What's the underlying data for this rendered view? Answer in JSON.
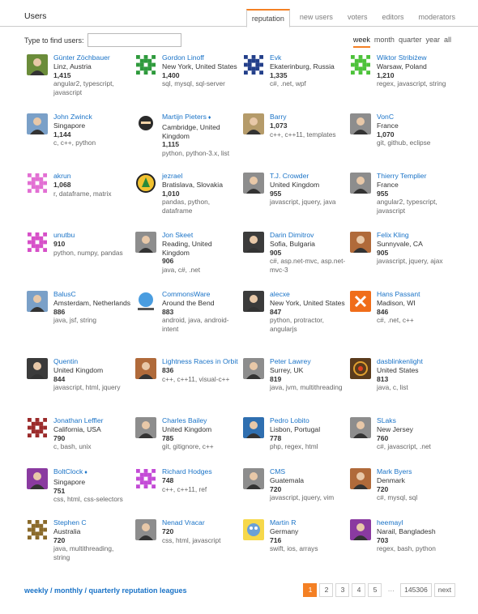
{
  "header": {
    "title": "Users",
    "tabs": [
      "reputation",
      "new users",
      "voters",
      "editors",
      "moderators"
    ]
  },
  "filter": {
    "label": "Type to find users:",
    "value": "",
    "placeholder": ""
  },
  "periods": [
    "week",
    "month",
    "quarter",
    "year",
    "all"
  ],
  "users": [
    {
      "name": "Günter Zöchbauer",
      "mod": false,
      "location": "Linz, Austria",
      "rep": "1,415",
      "tags": "angular2, typescript, javascript",
      "avatar": "photo-cyclist"
    },
    {
      "name": "Gordon Linoff",
      "mod": false,
      "location": "New York, United States",
      "rep": "1,400",
      "tags": "sql, mysql, sql-server",
      "avatar": "identicon-green"
    },
    {
      "name": "Evk",
      "mod": false,
      "location": "Ekaterinburg, Russia",
      "rep": "1,335",
      "tags": "c#, .net, wpf",
      "avatar": "identicon-navy"
    },
    {
      "name": "Wiktor Stribiżew",
      "mod": false,
      "location": "Warsaw, Poland",
      "rep": "1,210",
      "tags": "regex, javascript, string",
      "avatar": "identicon-lime"
    },
    {
      "name": "John Zwinck",
      "mod": false,
      "location": "Singapore",
      "rep": "1,144",
      "tags": "c, c++, python",
      "avatar": "photo-landscape"
    },
    {
      "name": "Martijn Pieters",
      "mod": true,
      "location": "Cambridge, United Kingdom",
      "rep": "1,115",
      "tags": "python, python-3.x, list",
      "avatar": "photo-ninja"
    },
    {
      "name": "Barry",
      "mod": false,
      "location": "",
      "rep": "1,073",
      "tags": "c++, c++11, templates",
      "avatar": "photo-dog"
    },
    {
      "name": "VonC",
      "mod": false,
      "location": "France",
      "rep": "1,070",
      "tags": "git, github, eclipse",
      "avatar": "photo-portrait"
    },
    {
      "name": "akrun",
      "mod": false,
      "location": "",
      "rep": "1,068",
      "tags": "r, dataframe, matrix",
      "avatar": "identicon-pink"
    },
    {
      "name": "jezrael",
      "mod": false,
      "location": "Bratislava, Slovakia",
      "rep": "1,010",
      "tags": "pandas, python, dataframe",
      "avatar": "logo-compass"
    },
    {
      "name": "T.J. Crowder",
      "mod": false,
      "location": "United Kingdom",
      "rep": "955",
      "tags": "javascript, jquery, java",
      "avatar": "photo-portrait"
    },
    {
      "name": "Thierry Templier",
      "mod": false,
      "location": "France",
      "rep": "955",
      "tags": "angular2, typescript, javascript",
      "avatar": "photo-portrait"
    },
    {
      "name": "unutbu",
      "mod": false,
      "location": "",
      "rep": "910",
      "tags": "python, numpy, pandas",
      "avatar": "identicon-magenta"
    },
    {
      "name": "Jon Skeet",
      "mod": false,
      "location": "Reading, United Kingdom",
      "rep": "906",
      "tags": "java, c#, .net",
      "avatar": "photo-portrait"
    },
    {
      "name": "Darin Dimitrov",
      "mod": false,
      "location": "Sofia, Bulgaria",
      "rep": "905",
      "tags": "c#, asp.net-mvc, asp.net-mvc-3",
      "avatar": "photo-dark"
    },
    {
      "name": "Felix Kling",
      "mod": false,
      "location": "Sunnyvale, CA",
      "rep": "905",
      "tags": "javascript, jquery, ajax",
      "avatar": "photo-warm"
    },
    {
      "name": "BalusC",
      "mod": false,
      "location": "Amsterdam, Netherlands",
      "rep": "886",
      "tags": "java, jsf, string",
      "avatar": "photo-landscape"
    },
    {
      "name": "CommonsWare",
      "mod": false,
      "location": "Around the Bend",
      "rep": "883",
      "tags": "android, java, android-intent",
      "avatar": "logo-globe"
    },
    {
      "name": "alecxe",
      "mod": false,
      "location": "New York, United States",
      "rep": "847",
      "tags": "python, protractor, angularjs",
      "avatar": "photo-dark"
    },
    {
      "name": "Hans Passant",
      "mod": false,
      "location": "Madison, WI",
      "rep": "846",
      "tags": "c#, .net, c++",
      "avatar": "logo-orange"
    },
    {
      "name": "Quentin",
      "mod": false,
      "location": "United Kingdom",
      "rep": "844",
      "tags": "javascript, html, jquery",
      "avatar": "photo-dark"
    },
    {
      "name": "Lightness Races in Orbit",
      "mod": false,
      "location": "",
      "rep": "836",
      "tags": "c++, c++11, visual-c++",
      "avatar": "photo-warm"
    },
    {
      "name": "Peter Lawrey",
      "mod": false,
      "location": "Surrey, UK",
      "rep": "819",
      "tags": "java, jvm, multithreading",
      "avatar": "photo-portrait"
    },
    {
      "name": "dasblinkenlight",
      "mod": false,
      "location": "United States",
      "rep": "813",
      "tags": "java, c, list",
      "avatar": "logo-ring"
    },
    {
      "name": "Jonathan Leffler",
      "mod": false,
      "location": "California, USA",
      "rep": "790",
      "tags": "c, bash, unix",
      "avatar": "identicon-red"
    },
    {
      "name": "Charles Bailey",
      "mod": false,
      "location": "United Kingdom",
      "rep": "785",
      "tags": "git, gitignore, c++",
      "avatar": "photo-portrait"
    },
    {
      "name": "Pedro Lobito",
      "mod": false,
      "location": "Lisbon, Portugal",
      "rep": "778",
      "tags": "php, regex, html",
      "avatar": "photo-blue"
    },
    {
      "name": "SLaks",
      "mod": false,
      "location": "New Jersey",
      "rep": "760",
      "tags": "c#, javascript, .net",
      "avatar": "photo-portrait"
    },
    {
      "name": "BoltClock",
      "mod": true,
      "location": "Singapore",
      "rep": "751",
      "tags": "css, html, css-selectors",
      "avatar": "photo-colorful"
    },
    {
      "name": "Richard Hodges",
      "mod": false,
      "location": "",
      "rep": "748",
      "tags": "c++, c++11, ref",
      "avatar": "identicon-violet"
    },
    {
      "name": "CMS",
      "mod": false,
      "location": "Guatemala",
      "rep": "720",
      "tags": "javascript, jquery, vim",
      "avatar": "photo-portrait"
    },
    {
      "name": "Mark Byers",
      "mod": false,
      "location": "Denmark",
      "rep": "720",
      "tags": "c#, mysql, sql",
      "avatar": "photo-warm"
    },
    {
      "name": "Stephen C",
      "mod": false,
      "location": "Australia",
      "rep": "720",
      "tags": "java, multithreading, string",
      "avatar": "identicon-brown"
    },
    {
      "name": "Nenad Vracar",
      "mod": false,
      "location": "",
      "rep": "720",
      "tags": "css, html, javascript",
      "avatar": "photo-portrait"
    },
    {
      "name": "Martin R",
      "mod": false,
      "location": "Germany",
      "rep": "716",
      "tags": "swift, ios, arrays",
      "avatar": "photo-cartoon"
    },
    {
      "name": "heemayl",
      "mod": false,
      "location": "Narail, Bangladesh",
      "rep": "703",
      "tags": "regex, bash, python",
      "avatar": "photo-colorful"
    }
  ],
  "footer": {
    "leagues_link": "weekly / monthly / quarterly reputation leagues",
    "pages": [
      "1",
      "2",
      "3",
      "4",
      "5",
      "…",
      "145306",
      "next"
    ]
  },
  "colors": {
    "accent": "#f48024",
    "link": "#1a73c7"
  }
}
